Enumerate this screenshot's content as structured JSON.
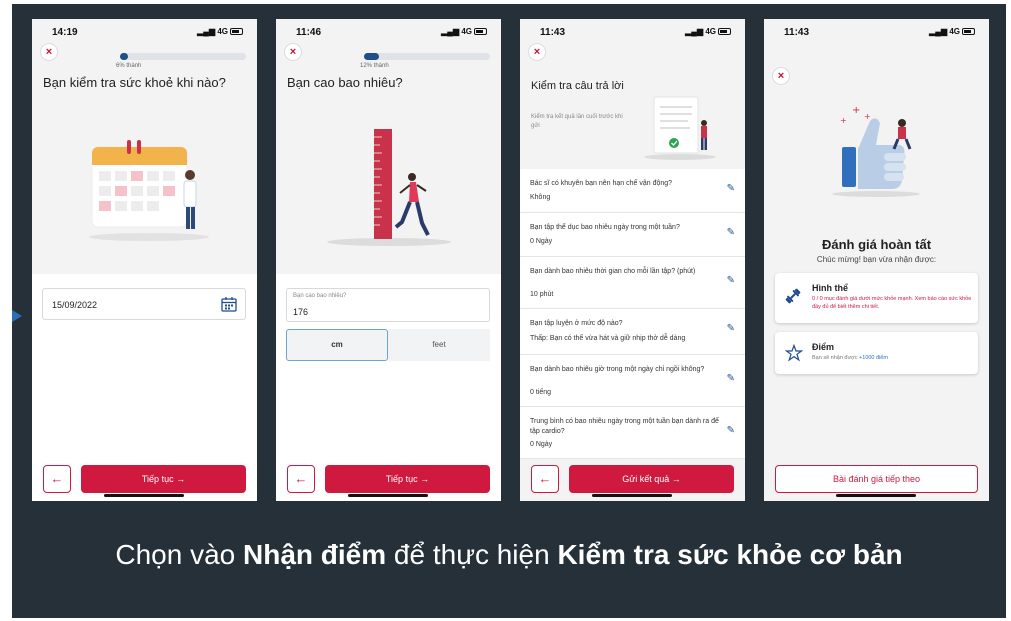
{
  "caption": {
    "part1": "Chọn vào ",
    "bold1": "Nhận điểm",
    "part2": " để thực hiện ",
    "bold2": "Kiểm tra sức khỏe cơ bản"
  },
  "screens": [
    {
      "time": "14:19",
      "signal": "4G",
      "progress_label": "6% thành",
      "progress": 0.06,
      "question": "Bạn kiểm tra sức khoẻ khi nào?",
      "date_value": "15/09/2022",
      "continue_label": "Tiếp tục",
      "arrow": "→",
      "back_arrow": "←",
      "close": "×"
    },
    {
      "time": "11:46",
      "signal": "4G",
      "progress_label": "12% thành",
      "progress": 0.12,
      "question": "Bạn cao bao nhiêu?",
      "height_label": "Bạn cao bao nhiêu?",
      "height_value": "176",
      "unit_cm": "cm",
      "unit_feet": "feet",
      "continue_label": "Tiếp tục",
      "arrow": "→",
      "back_arrow": "←",
      "close": "×"
    },
    {
      "time": "11:43",
      "signal": "4G",
      "title": "Kiểm tra câu trả lời",
      "subtitle": "Kiểm tra kết quả lần cuối trước khi gửi",
      "questions": [
        {
          "q": "Bác sĩ có khuyên bạn nên hạn chế vận động?",
          "a": "Không"
        },
        {
          "q": "Bạn tập thể dục bao nhiêu ngày trong một tuần?",
          "a": "0 Ngày"
        },
        {
          "q": "Bạn dành bao nhiêu thời gian cho mỗi lần tập? (phút)",
          "a": "10 phút"
        },
        {
          "q": "Bạn tập luyện ở mức độ nào?",
          "a": "Thấp: Bạn có thể vừa hát và giữ nhịp thở dễ dàng"
        },
        {
          "q": "Bạn dành bao nhiêu giờ trong một ngày chỉ ngồi không?",
          "a": "0 tiếng"
        },
        {
          "q": "Trung bình có bao nhiêu ngày trong một tuần bạn dành ra để tập cardio?",
          "a": "0 Ngày"
        }
      ],
      "submit_label": "Gửi kết quả",
      "arrow": "→",
      "back_arrow": "←",
      "close": "×"
    },
    {
      "time": "11:43",
      "signal": "4G",
      "title": "Đánh giá hoàn tất",
      "subtitle": "Chúc mừng! bạn vừa nhận được:",
      "card1_title": "Hình thể",
      "card1_text": "0 / 0 mục đánh giá dưới mức khỏe mạnh. Xem báo cáo sức khỏe đầy đủ để biết thêm chi tiết.",
      "card2_title": "Điểm",
      "card2_text_prefix": "Bạn sẽ nhận được ",
      "card2_points": "+1000 điểm",
      "next_label": "Bài đánh giá tiếp theo",
      "close": "×"
    }
  ],
  "colors": {
    "background": "#253038",
    "accent": "#d0193f",
    "progress": "#1e4e8c",
    "pen": "#1e4e8c"
  }
}
